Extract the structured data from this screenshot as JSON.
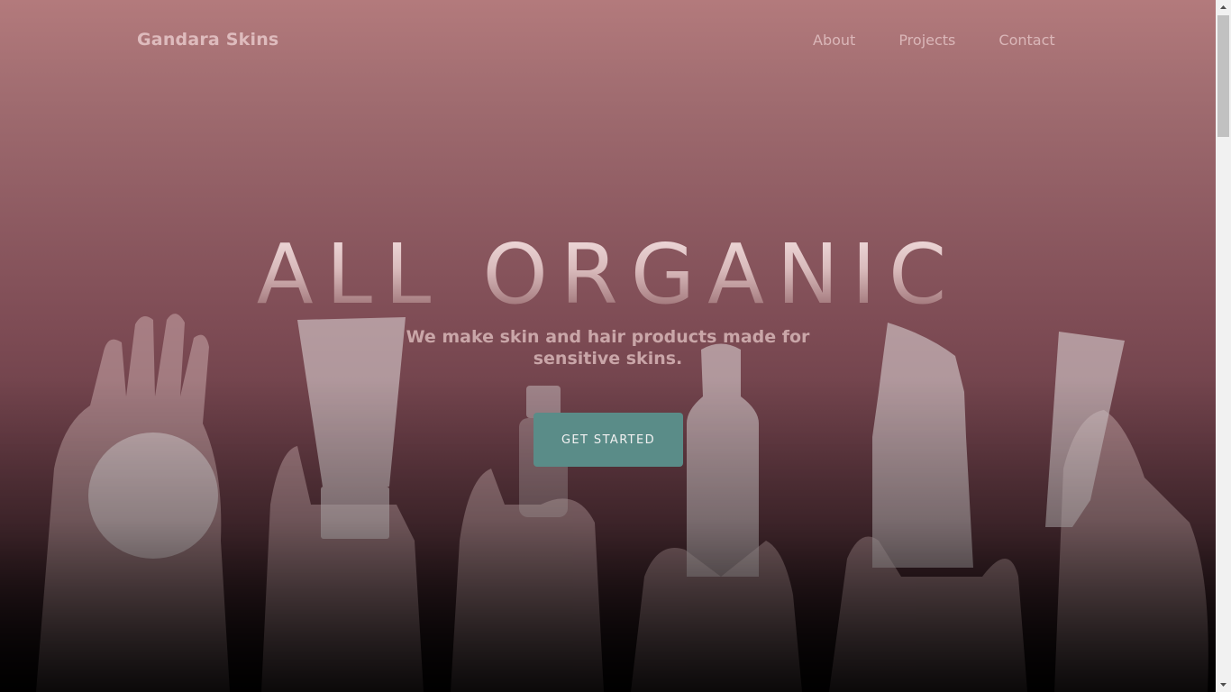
{
  "nav": {
    "brand": "Gandara Skins",
    "links": [
      {
        "label": "About"
      },
      {
        "label": "Projects"
      },
      {
        "label": "Contact"
      }
    ]
  },
  "hero": {
    "headline": "ALL ORGANIC",
    "subtitle_line1": "We make skin and hair products made for",
    "subtitle_line2": "sensitive skins.",
    "cta_label": "GET STARTED"
  },
  "colors": {
    "accent": "#5a8c88",
    "background_top": "#b37a7c",
    "background_bottom": "#0b0708"
  },
  "scrollbar": {
    "position_fraction": 0
  }
}
